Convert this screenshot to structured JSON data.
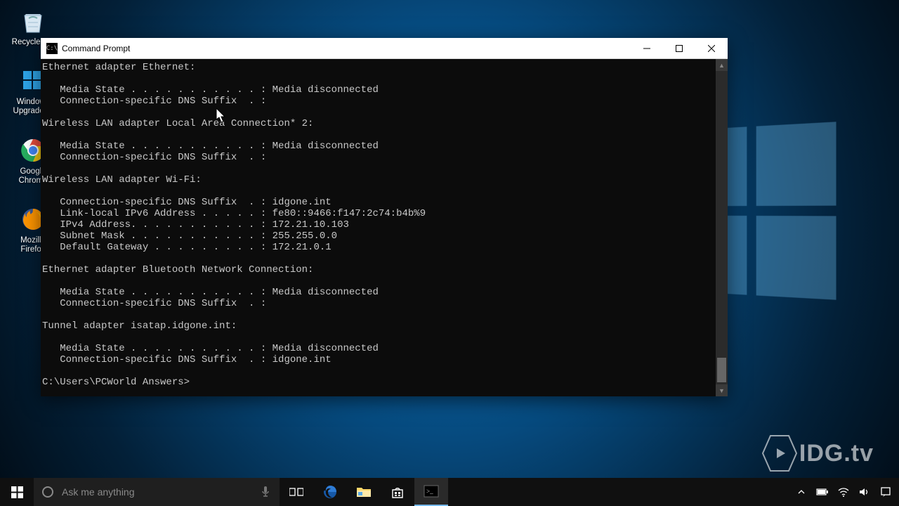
{
  "desktop": {
    "icons": [
      {
        "label": "Recycle Bin"
      },
      {
        "label": "Windows Upgrade ..."
      },
      {
        "label": "Google Chrome"
      },
      {
        "label": "Mozilla Firefox"
      }
    ]
  },
  "window": {
    "title": "Command Prompt",
    "terminal_lines": [
      "Ethernet adapter Ethernet:",
      "",
      "   Media State . . . . . . . . . . . : Media disconnected",
      "   Connection-specific DNS Suffix  . :",
      "",
      "Wireless LAN adapter Local Area Connection* 2:",
      "",
      "   Media State . . . . . . . . . . . : Media disconnected",
      "   Connection-specific DNS Suffix  . :",
      "",
      "Wireless LAN adapter Wi-Fi:",
      "",
      "   Connection-specific DNS Suffix  . : idgone.int",
      "   Link-local IPv6 Address . . . . . : fe80::9466:f147:2c74:b4b%9",
      "   IPv4 Address. . . . . . . . . . . : 172.21.10.103",
      "   Subnet Mask . . . . . . . . . . . : 255.255.0.0",
      "   Default Gateway . . . . . . . . . : 172.21.0.1",
      "",
      "Ethernet adapter Bluetooth Network Connection:",
      "",
      "   Media State . . . . . . . . . . . : Media disconnected",
      "   Connection-specific DNS Suffix  . :",
      "",
      "Tunnel adapter isatap.idgone.int:",
      "",
      "   Media State . . . . . . . . . . . : Media disconnected",
      "   Connection-specific DNS Suffix  . : idgone.int",
      "",
      "C:\\Users\\PCWorld Answers>"
    ]
  },
  "taskbar": {
    "search_placeholder": "Ask me anything"
  },
  "watermark": "IDG.tv"
}
